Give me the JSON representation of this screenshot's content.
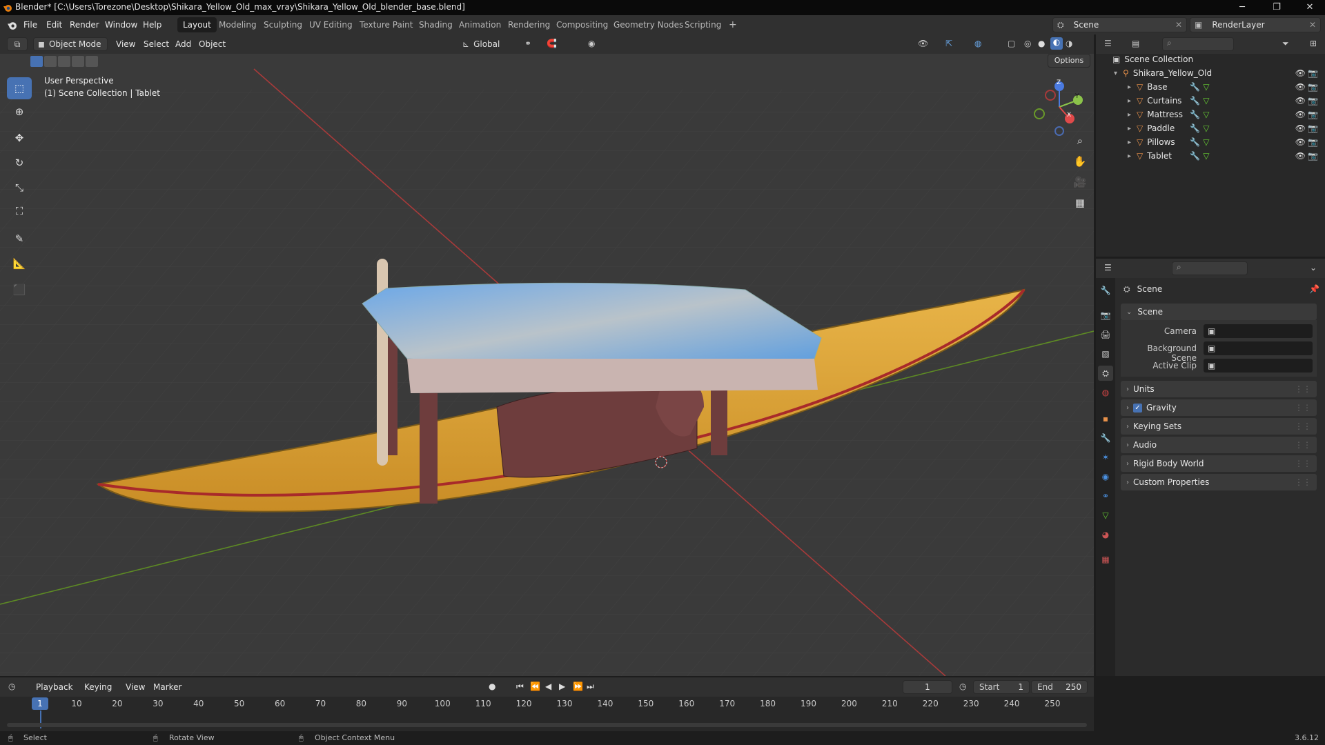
{
  "window": {
    "title": "Blender* [C:\\Users\\Torezone\\Desktop\\Shikara_Yellow_Old_max_vray\\Shikara_Yellow_Old_blender_base.blend]",
    "minimize": "─",
    "maximize": "❐",
    "close": "✕"
  },
  "menus": [
    "File",
    "Edit",
    "Render",
    "Window",
    "Help"
  ],
  "workspaces": [
    "Layout",
    "Modeling",
    "Sculpting",
    "UV Editing",
    "Texture Paint",
    "Shading",
    "Animation",
    "Rendering",
    "Compositing",
    "Geometry Nodes",
    "Scripting"
  ],
  "workspace_add": "+",
  "scene_selector": "Scene",
  "render_layer": "RenderLayer",
  "viewport": {
    "mode": "Object Mode",
    "menus": [
      "View",
      "Select",
      "Add",
      "Object"
    ],
    "transform_orientation": "Global",
    "options": "Options",
    "perspective_label": "User Perspective",
    "collection_label": "(1) Scene Collection | Tablet",
    "gizmo": {
      "x": "X",
      "y": "Y",
      "z": "Z"
    }
  },
  "outliner": {
    "root": "Scene Collection",
    "collection": "Shikara_Yellow_Old",
    "objects": [
      "Base",
      "Curtains",
      "Mattress",
      "Paddle",
      "Pillows",
      "Tablet"
    ]
  },
  "properties": {
    "header": "Scene",
    "section": "Scene",
    "fields": [
      {
        "label": "Camera",
        "value": ""
      },
      {
        "label": "Background Scene",
        "value": ""
      },
      {
        "label": "Active Clip",
        "value": ""
      }
    ],
    "panels": [
      "Units",
      "Gravity",
      "Keying Sets",
      "Audio",
      "Rigid Body World",
      "Custom Properties"
    ],
    "gravity_checked": true
  },
  "timeline": {
    "menus": [
      "Playback",
      "Keying",
      "View",
      "Marker"
    ],
    "current_frame": "1",
    "start_label": "Start",
    "start": "1",
    "end_label": "End",
    "end": "250",
    "ruler": [
      "1",
      "10",
      "20",
      "30",
      "40",
      "50",
      "60",
      "70",
      "80",
      "90",
      "100",
      "110",
      "120",
      "130",
      "140",
      "150",
      "160",
      "170",
      "180",
      "190",
      "200",
      "210",
      "220",
      "230",
      "240",
      "250"
    ]
  },
  "status": {
    "select": "Select",
    "rotate": "Rotate View",
    "context": "Object Context Menu",
    "version": "3.6.12"
  },
  "colors": {
    "accent": "#4772b3",
    "boat": "#e0a93a",
    "canopy_blue": "#5b9de0",
    "grid_x": "#b33",
    "grid_y": "#6a9a2a"
  }
}
